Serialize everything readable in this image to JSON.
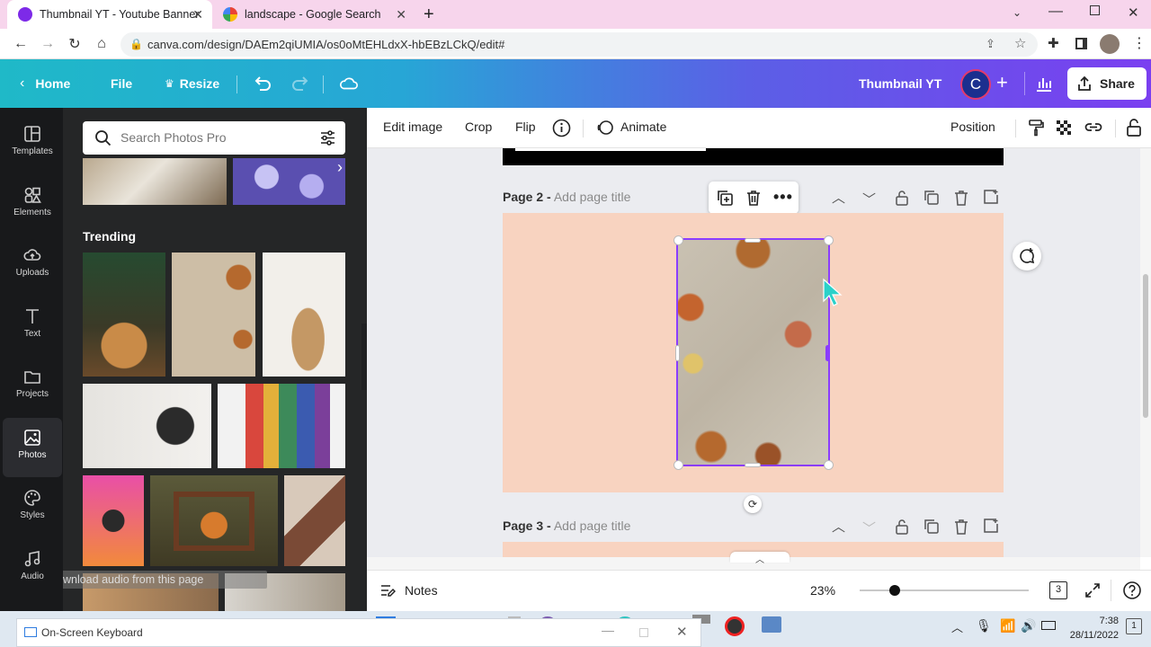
{
  "browser": {
    "tabs": [
      {
        "title": "Thumbnail YT - Youtube Banner",
        "active": true
      },
      {
        "title": "landscape - Google Search",
        "active": false
      }
    ],
    "url": "canva.com/design/DAEm2qiUMIA/os0oMtEHLdxX-hbEBzLCkQ/edit#"
  },
  "canva_bar": {
    "home": "Home",
    "file": "File",
    "resize": "Resize",
    "doc_title": "Thumbnail YT",
    "avatar_initial": "C",
    "share": "Share"
  },
  "sidebar": {
    "items": [
      {
        "label": "Templates",
        "icon": "templates-icon"
      },
      {
        "label": "Elements",
        "icon": "elements-icon"
      },
      {
        "label": "Uploads",
        "icon": "uploads-icon"
      },
      {
        "label": "Text",
        "icon": "text-icon"
      },
      {
        "label": "Projects",
        "icon": "projects-icon"
      },
      {
        "label": "Photos",
        "icon": "photos-icon",
        "active": true
      },
      {
        "label": "Styles",
        "icon": "styles-icon"
      },
      {
        "label": "Audio",
        "icon": "audio-icon"
      }
    ]
  },
  "panel": {
    "search_placeholder": "Search Photos Pro",
    "trending": "Trending",
    "download_overlay": "Download audio from this page"
  },
  "editbar": {
    "edit_image": "Edit image",
    "crop": "Crop",
    "flip": "Flip",
    "animate": "Animate",
    "position": "Position"
  },
  "pages": [
    {
      "label": "Page 2 -",
      "title_placeholder": "Add page title"
    },
    {
      "label": "Page 3 -",
      "title_placeholder": "Add page title"
    }
  ],
  "footer": {
    "notes": "Notes",
    "zoom": "23%",
    "zoom_fraction": 0.21,
    "page_count": "3"
  },
  "taskbar": {
    "osk_title": "On-Screen Keyboard",
    "time": "7:38",
    "date": "28/11/2022",
    "notification_count": "1"
  },
  "colors": {
    "page_bg": "#f8d3c0",
    "selection": "#8b3dff",
    "toolbar_gradient_start": "#1fb9c8",
    "toolbar_gradient_end": "#7a3ff0"
  }
}
